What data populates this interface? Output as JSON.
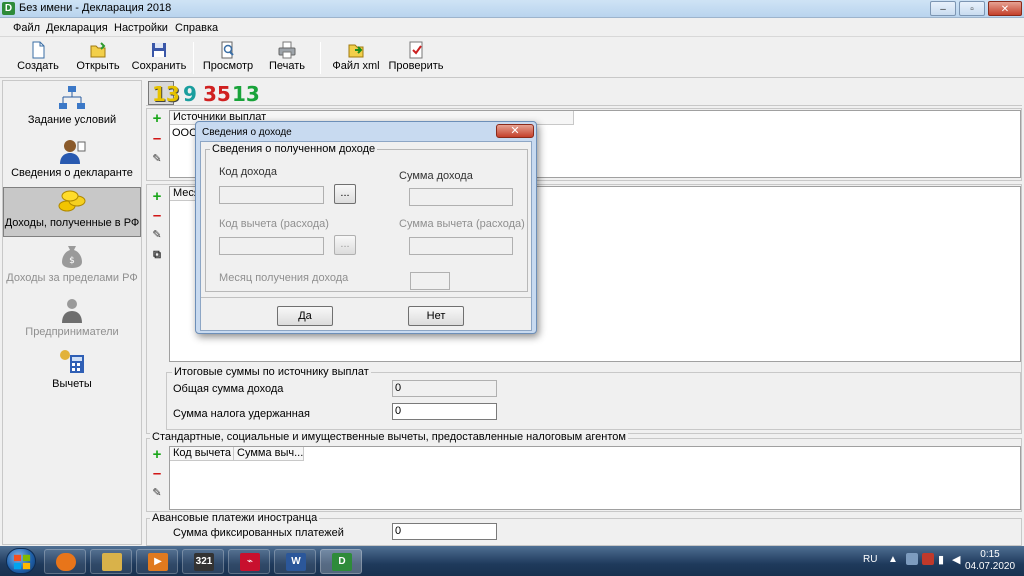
{
  "window": {
    "title": "Без имени - Декларация 2018",
    "app_icon_letter": "D",
    "controls": [
      "–",
      "▫",
      "✕"
    ]
  },
  "menu": [
    "Файл",
    "Декларация",
    "Настройки",
    "Справка"
  ],
  "toolbar": [
    {
      "label": "Создать",
      "icon": "new-document-icon"
    },
    {
      "label": "Открыть",
      "icon": "open-folder-icon"
    },
    {
      "label": "Сохранить",
      "icon": "save-icon"
    },
    {
      "label": "Просмотр",
      "icon": "preview-icon"
    },
    {
      "label": "Печать",
      "icon": "printer-icon"
    },
    {
      "label": "Файл xml",
      "icon": "export-xml-icon"
    },
    {
      "label": "Проверить",
      "icon": "check-icon"
    }
  ],
  "leftnav": [
    {
      "label": "Задание условий",
      "icon": "network-icon",
      "state": "normal"
    },
    {
      "label": "Сведения о декларанте",
      "icon": "user-icon",
      "state": "normal"
    },
    {
      "label": "Доходы, полученные в РФ",
      "icon": "coins-icon",
      "state": "selected"
    },
    {
      "label": "Доходы за пределами РФ",
      "icon": "money-bag-icon",
      "state": "disabled"
    },
    {
      "label": "Предприниматели",
      "icon": "businessman-icon",
      "state": "disabled"
    },
    {
      "label": "Вычеты",
      "icon": "calculator-icon",
      "state": "normal"
    }
  ],
  "rates": [
    {
      "text": "13",
      "color": "#e6c200"
    },
    {
      "text": "9",
      "color": "#1a9e9e"
    },
    {
      "text": "35",
      "color": "#d02020"
    },
    {
      "text": "13",
      "color": "#19a33a"
    }
  ],
  "sources": {
    "col1": "Источники выплат",
    "row1": "ООО"
  },
  "months": {
    "col1": "Меся"
  },
  "totals": {
    "title": "Итоговые суммы по источнику выплат",
    "income_label": "Общая сумма дохода",
    "income_value": "0",
    "tax_label": "Сумма налога удержанная",
    "tax_value": "0"
  },
  "deductions": {
    "title": "Стандартные, социальные и имущественные вычеты, предоставленные налоговым агентом",
    "col1": "Код вычета",
    "col2": "Сумма выч..."
  },
  "advance": {
    "title": "Авансовые платежи иностранца",
    "label": "Сумма фиксированных платежей",
    "value": "0"
  },
  "dialog": {
    "title": "Сведения о доходе",
    "close": "✕",
    "group": "Сведения о полученном доходе",
    "income_code": "Код дохода",
    "income_sum": "Сумма дохода",
    "deduction_code": "Код вычета (расхода)",
    "deduction_sum": "Сумма вычета (расхода)",
    "month": "Месяц получения дохода",
    "browse": "...",
    "ok": "Да",
    "cancel": "Нет"
  },
  "taskbar": {
    "apps": [
      {
        "icon": "firefox-icon",
        "color": "#e8751a"
      },
      {
        "icon": "file-explorer-icon",
        "color": "#d9b24a"
      },
      {
        "icon": "media-player-icon",
        "color": "#e07a1f"
      },
      {
        "icon": "calendar-icon",
        "color": "#333333",
        "text": "321"
      },
      {
        "icon": "pdf-reader-icon",
        "color": "#c8102e"
      },
      {
        "icon": "word-icon",
        "color": "#2b579a",
        "text": "W"
      },
      {
        "icon": "declaration-app-icon",
        "color": "#2e8b3a",
        "text": "D"
      }
    ],
    "lang": "RU",
    "time": "0:15",
    "date": "04.07.2020"
  }
}
